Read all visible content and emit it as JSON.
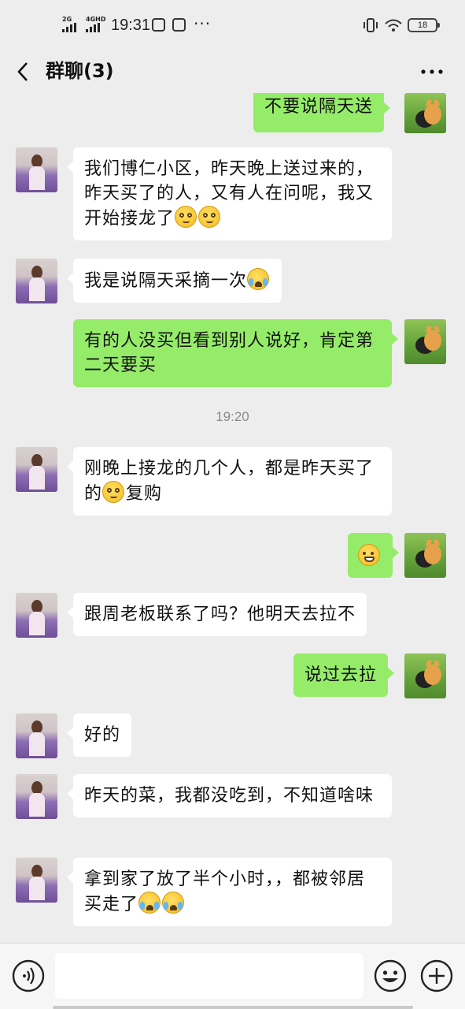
{
  "status_bar": {
    "network1": "2G",
    "network2": "4GHD",
    "time": "19:31",
    "battery": "18",
    "more": "···"
  },
  "header": {
    "title": "群聊(3)"
  },
  "messages": [
    {
      "side": "out",
      "text": "不要说隔天送"
    },
    {
      "side": "in",
      "text": "我们博仁小区，昨天晚上送过来的，昨天买了的人，又有人在问呢，我又开始接龙了",
      "emojis": [
        "blush",
        "blush"
      ]
    },
    {
      "side": "in",
      "text": "我是说隔天采摘一次",
      "emojis": [
        "cry"
      ]
    },
    {
      "side": "out",
      "text": "有的人没买但看到别人说好，肯定第二天要买"
    },
    {
      "type": "time",
      "text": "19:20"
    },
    {
      "side": "in",
      "text": "刚晚上接龙的几个人，都是昨天买了的",
      "emojis": [
        "blush"
      ],
      "text_after": "复购"
    },
    {
      "side": "out",
      "text": "",
      "emojis": [
        "grin"
      ]
    },
    {
      "side": "in",
      "text": "跟周老板联系了吗？他明天去拉不"
    },
    {
      "side": "out",
      "text": "说过去拉"
    },
    {
      "side": "in",
      "text": "好的"
    },
    {
      "side": "in",
      "text": "昨天的菜，我都没吃到，不知道啥味"
    },
    {
      "side": "in",
      "text": "拿到家了放了半个小时，，都被邻居买走了",
      "emojis": [
        "cry",
        "cry"
      ]
    }
  ],
  "input": {
    "placeholder": ""
  }
}
